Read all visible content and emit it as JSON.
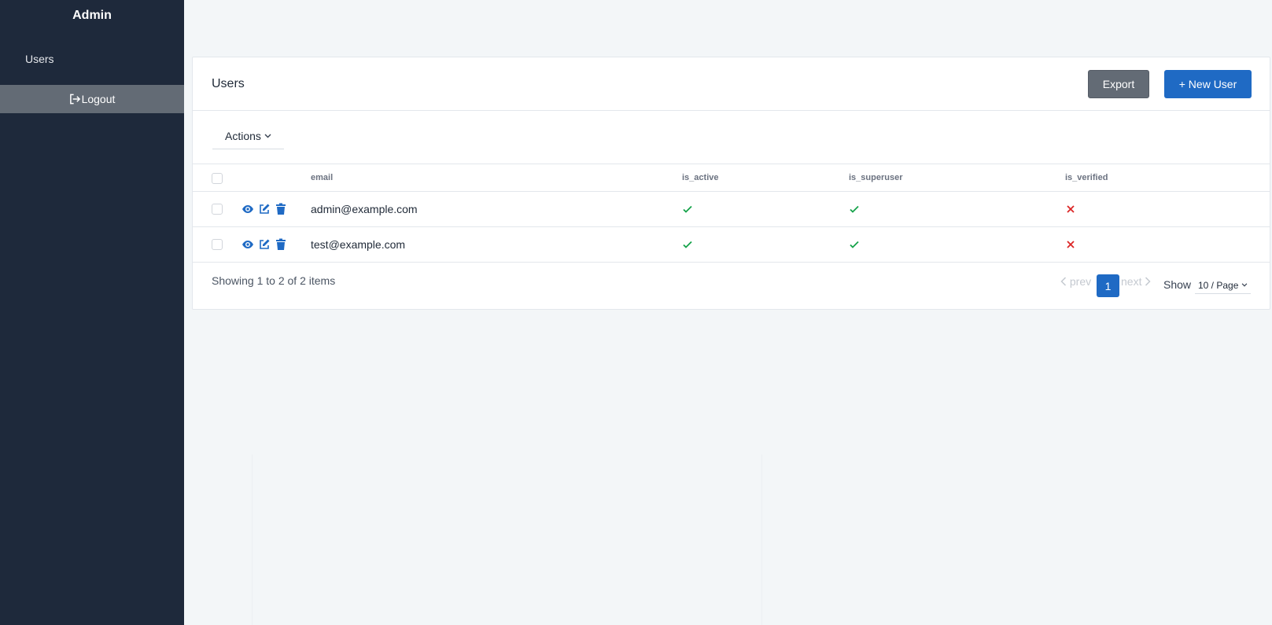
{
  "sidebar": {
    "brand": "Admin",
    "items": [
      {
        "label": "Users"
      }
    ],
    "logout_label": "Logout"
  },
  "card": {
    "title": "Users",
    "export_label": "Export",
    "new_label": "+ New User",
    "actions_label": "Actions"
  },
  "table": {
    "columns": [
      "email",
      "is_active",
      "is_superuser",
      "is_verified"
    ],
    "rows": [
      {
        "email": "admin@example.com",
        "is_active": true,
        "is_superuser": true,
        "is_verified": false
      },
      {
        "email": "test@example.com",
        "is_active": true,
        "is_superuser": true,
        "is_verified": false
      }
    ]
  },
  "footer": {
    "summary": "Showing 1 to 2 of 2 items",
    "prev_label": "prev",
    "page": "1",
    "next_label": "next",
    "show_label": "Show",
    "per_page": "10 / Page"
  },
  "colors": {
    "sidebar_bg": "#1e293b",
    "primary": "#1f6ac4",
    "check": "#16a34a",
    "cross": "#dc2626"
  }
}
